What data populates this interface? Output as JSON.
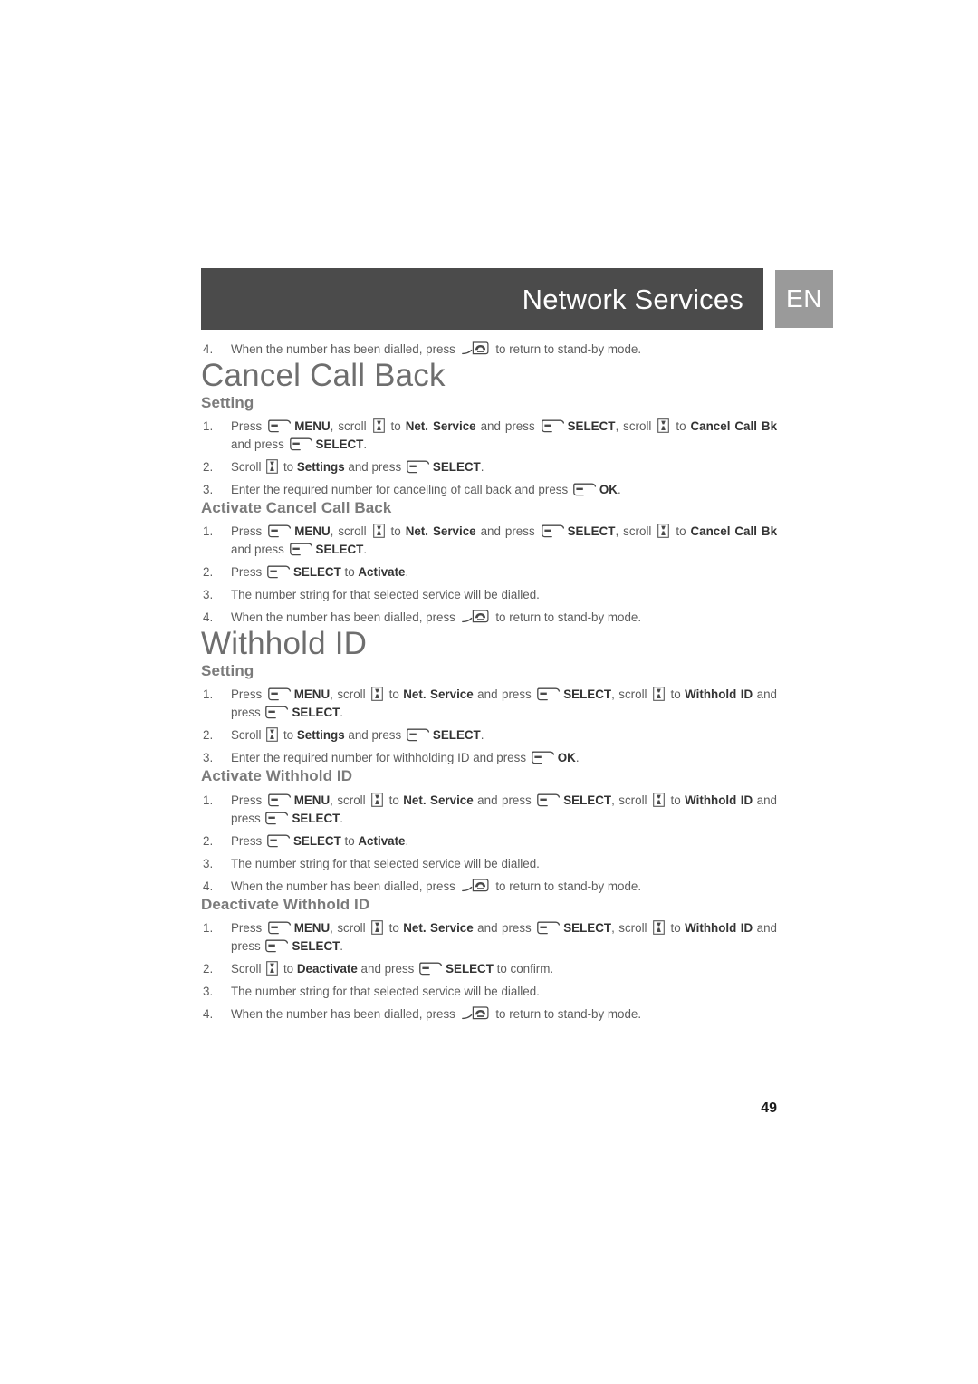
{
  "header": {
    "title": "Network Services",
    "language_badge": "EN"
  },
  "icons": {
    "softkey": "softkey-icon",
    "scroll": "scroll-key-icon",
    "hangup": "hangup-key-icon"
  },
  "top_step": {
    "number": "4.",
    "text_before": "When the number has been dialled, press",
    "text_after": "to return to stand-by mode."
  },
  "sections": [
    {
      "title": "Cancel Call Back",
      "groups": [
        {
          "heading": "Setting",
          "steps": [
            {
              "parts": [
                {
                  "t": "text",
                  "v": "Press "
                },
                {
                  "t": "icon",
                  "v": "softkey"
                },
                {
                  "t": "bold",
                  "v": "MENU"
                },
                {
                  "t": "text",
                  "v": ", scroll "
                },
                {
                  "t": "icon",
                  "v": "scroll"
                },
                {
                  "t": "text",
                  "v": " to "
                },
                {
                  "t": "bold",
                  "v": "Net. Service"
                },
                {
                  "t": "text",
                  "v": " and press "
                },
                {
                  "t": "icon",
                  "v": "softkey"
                },
                {
                  "t": "bold",
                  "v": "SELECT"
                },
                {
                  "t": "text",
                  "v": ", scroll "
                },
                {
                  "t": "icon",
                  "v": "scroll"
                },
                {
                  "t": "text",
                  "v": " to "
                },
                {
                  "t": "bold",
                  "v": "Cancel Call Bk"
                },
                {
                  "t": "text",
                  "v": " and press "
                },
                {
                  "t": "icon",
                  "v": "softkey"
                },
                {
                  "t": "bold",
                  "v": "SELECT"
                },
                {
                  "t": "text",
                  "v": "."
                }
              ]
            },
            {
              "parts": [
                {
                  "t": "text",
                  "v": "Scroll "
                },
                {
                  "t": "icon",
                  "v": "scroll"
                },
                {
                  "t": "text",
                  "v": " to "
                },
                {
                  "t": "bold",
                  "v": "Settings"
                },
                {
                  "t": "text",
                  "v": " and press "
                },
                {
                  "t": "icon",
                  "v": "softkey"
                },
                {
                  "t": "bold",
                  "v": "SELECT"
                },
                {
                  "t": "text",
                  "v": "."
                }
              ]
            },
            {
              "parts": [
                {
                  "t": "text",
                  "v": "Enter the required number for cancelling of call back and press "
                },
                {
                  "t": "icon",
                  "v": "softkey"
                },
                {
                  "t": "bold",
                  "v": "OK"
                },
                {
                  "t": "text",
                  "v": "."
                }
              ]
            }
          ]
        },
        {
          "heading": "Activate Cancel Call Back",
          "steps": [
            {
              "parts": [
                {
                  "t": "text",
                  "v": "Press "
                },
                {
                  "t": "icon",
                  "v": "softkey"
                },
                {
                  "t": "bold",
                  "v": "MENU"
                },
                {
                  "t": "text",
                  "v": ", scroll "
                },
                {
                  "t": "icon",
                  "v": "scroll"
                },
                {
                  "t": "text",
                  "v": " to "
                },
                {
                  "t": "bold",
                  "v": "Net. Service"
                },
                {
                  "t": "text",
                  "v": " and press "
                },
                {
                  "t": "icon",
                  "v": "softkey"
                },
                {
                  "t": "bold",
                  "v": "SELECT"
                },
                {
                  "t": "text",
                  "v": ", scroll "
                },
                {
                  "t": "icon",
                  "v": "scroll"
                },
                {
                  "t": "text",
                  "v": " to "
                },
                {
                  "t": "bold",
                  "v": "Cancel Call Bk"
                },
                {
                  "t": "text",
                  "v": " and press "
                },
                {
                  "t": "icon",
                  "v": "softkey"
                },
                {
                  "t": "bold",
                  "v": "SELECT"
                },
                {
                  "t": "text",
                  "v": "."
                }
              ]
            },
            {
              "parts": [
                {
                  "t": "text",
                  "v": "Press "
                },
                {
                  "t": "icon",
                  "v": "softkey"
                },
                {
                  "t": "bold",
                  "v": "SELECT"
                },
                {
                  "t": "text",
                  "v": " to "
                },
                {
                  "t": "bold",
                  "v": "Activate"
                },
                {
                  "t": "text",
                  "v": "."
                }
              ]
            },
            {
              "parts": [
                {
                  "t": "text",
                  "v": "The number string for that selected service will be dialled."
                }
              ]
            },
            {
              "parts": [
                {
                  "t": "text",
                  "v": "When the number has been dialled, press "
                },
                {
                  "t": "icon",
                  "v": "hangup"
                },
                {
                  "t": "text",
                  "v": " to return to stand-by mode."
                }
              ]
            }
          ]
        }
      ]
    },
    {
      "title": "Withhold ID",
      "groups": [
        {
          "heading": "Setting",
          "steps": [
            {
              "parts": [
                {
                  "t": "text",
                  "v": "Press "
                },
                {
                  "t": "icon",
                  "v": "softkey"
                },
                {
                  "t": "bold",
                  "v": "MENU"
                },
                {
                  "t": "text",
                  "v": ", scroll "
                },
                {
                  "t": "icon",
                  "v": "scroll"
                },
                {
                  "t": "text",
                  "v": " to "
                },
                {
                  "t": "bold",
                  "v": "Net. Service"
                },
                {
                  "t": "text",
                  "v": " and press "
                },
                {
                  "t": "icon",
                  "v": "softkey"
                },
                {
                  "t": "bold",
                  "v": "SELECT"
                },
                {
                  "t": "text",
                  "v": ", scroll "
                },
                {
                  "t": "icon",
                  "v": "scroll"
                },
                {
                  "t": "text",
                  "v": " to "
                },
                {
                  "t": "bold",
                  "v": "Withhold ID"
                },
                {
                  "t": "text",
                  "v": " and press "
                },
                {
                  "t": "icon",
                  "v": "softkey"
                },
                {
                  "t": "bold",
                  "v": "SELECT"
                },
                {
                  "t": "text",
                  "v": "."
                }
              ]
            },
            {
              "parts": [
                {
                  "t": "text",
                  "v": "Scroll "
                },
                {
                  "t": "icon",
                  "v": "scroll"
                },
                {
                  "t": "text",
                  "v": " to "
                },
                {
                  "t": "bold",
                  "v": "Settings"
                },
                {
                  "t": "text",
                  "v": " and press "
                },
                {
                  "t": "icon",
                  "v": "softkey"
                },
                {
                  "t": "bold",
                  "v": "SELECT"
                },
                {
                  "t": "text",
                  "v": "."
                }
              ]
            },
            {
              "parts": [
                {
                  "t": "text",
                  "v": "Enter the required number for withholding ID and press "
                },
                {
                  "t": "icon",
                  "v": "softkey"
                },
                {
                  "t": "bold",
                  "v": "OK"
                },
                {
                  "t": "text",
                  "v": "."
                }
              ]
            }
          ]
        },
        {
          "heading": "Activate Withhold ID",
          "steps": [
            {
              "parts": [
                {
                  "t": "text",
                  "v": "Press "
                },
                {
                  "t": "icon",
                  "v": "softkey"
                },
                {
                  "t": "bold",
                  "v": "MENU"
                },
                {
                  "t": "text",
                  "v": ", scroll "
                },
                {
                  "t": "icon",
                  "v": "scroll"
                },
                {
                  "t": "text",
                  "v": " to "
                },
                {
                  "t": "bold",
                  "v": "Net. Service"
                },
                {
                  "t": "text",
                  "v": " and press "
                },
                {
                  "t": "icon",
                  "v": "softkey"
                },
                {
                  "t": "bold",
                  "v": "SELECT"
                },
                {
                  "t": "text",
                  "v": ", scroll "
                },
                {
                  "t": "icon",
                  "v": "scroll"
                },
                {
                  "t": "text",
                  "v": " to "
                },
                {
                  "t": "bold",
                  "v": "Withhold ID"
                },
                {
                  "t": "text",
                  "v": " and press "
                },
                {
                  "t": "icon",
                  "v": "softkey"
                },
                {
                  "t": "bold",
                  "v": "SELECT"
                },
                {
                  "t": "text",
                  "v": "."
                }
              ]
            },
            {
              "parts": [
                {
                  "t": "text",
                  "v": "Press "
                },
                {
                  "t": "icon",
                  "v": "softkey"
                },
                {
                  "t": "bold",
                  "v": "SELECT"
                },
                {
                  "t": "text",
                  "v": " to "
                },
                {
                  "t": "bold",
                  "v": "Activate"
                },
                {
                  "t": "text",
                  "v": "."
                }
              ]
            },
            {
              "parts": [
                {
                  "t": "text",
                  "v": "The number string for that selected service will be dialled."
                }
              ]
            },
            {
              "parts": [
                {
                  "t": "text",
                  "v": "When the number has been dialled, press "
                },
                {
                  "t": "icon",
                  "v": "hangup"
                },
                {
                  "t": "text",
                  "v": " to return to stand-by mode."
                }
              ]
            }
          ]
        },
        {
          "heading": "Deactivate Withhold ID",
          "steps": [
            {
              "parts": [
                {
                  "t": "text",
                  "v": "Press "
                },
                {
                  "t": "icon",
                  "v": "softkey"
                },
                {
                  "t": "bold",
                  "v": "MENU"
                },
                {
                  "t": "text",
                  "v": ", scroll "
                },
                {
                  "t": "icon",
                  "v": "scroll"
                },
                {
                  "t": "text",
                  "v": " to "
                },
                {
                  "t": "bold",
                  "v": "Net. Service"
                },
                {
                  "t": "text",
                  "v": " and press "
                },
                {
                  "t": "icon",
                  "v": "softkey"
                },
                {
                  "t": "bold",
                  "v": "SELECT"
                },
                {
                  "t": "text",
                  "v": ", scroll "
                },
                {
                  "t": "icon",
                  "v": "scroll"
                },
                {
                  "t": "text",
                  "v": " to "
                },
                {
                  "t": "bold",
                  "v": "Withhold ID"
                },
                {
                  "t": "text",
                  "v": " and press "
                },
                {
                  "t": "icon",
                  "v": "softkey"
                },
                {
                  "t": "bold",
                  "v": "SELECT"
                },
                {
                  "t": "text",
                  "v": "."
                }
              ]
            },
            {
              "parts": [
                {
                  "t": "text",
                  "v": "Scroll "
                },
                {
                  "t": "icon",
                  "v": "scroll"
                },
                {
                  "t": "text",
                  "v": " to "
                },
                {
                  "t": "bold",
                  "v": "Deactivate"
                },
                {
                  "t": "text",
                  "v": " and press "
                },
                {
                  "t": "icon",
                  "v": "softkey"
                },
                {
                  "t": "bold",
                  "v": "SELECT"
                },
                {
                  "t": "text",
                  "v": " to confirm."
                }
              ]
            },
            {
              "parts": [
                {
                  "t": "text",
                  "v": "The number string for that selected service will be dialled."
                }
              ]
            },
            {
              "parts": [
                {
                  "t": "text",
                  "v": "When the number has been dialled, press "
                },
                {
                  "t": "icon",
                  "v": "hangup"
                },
                {
                  "t": "text",
                  "v": " to return to stand-by mode."
                }
              ]
            }
          ]
        }
      ]
    }
  ],
  "page_number": "49"
}
